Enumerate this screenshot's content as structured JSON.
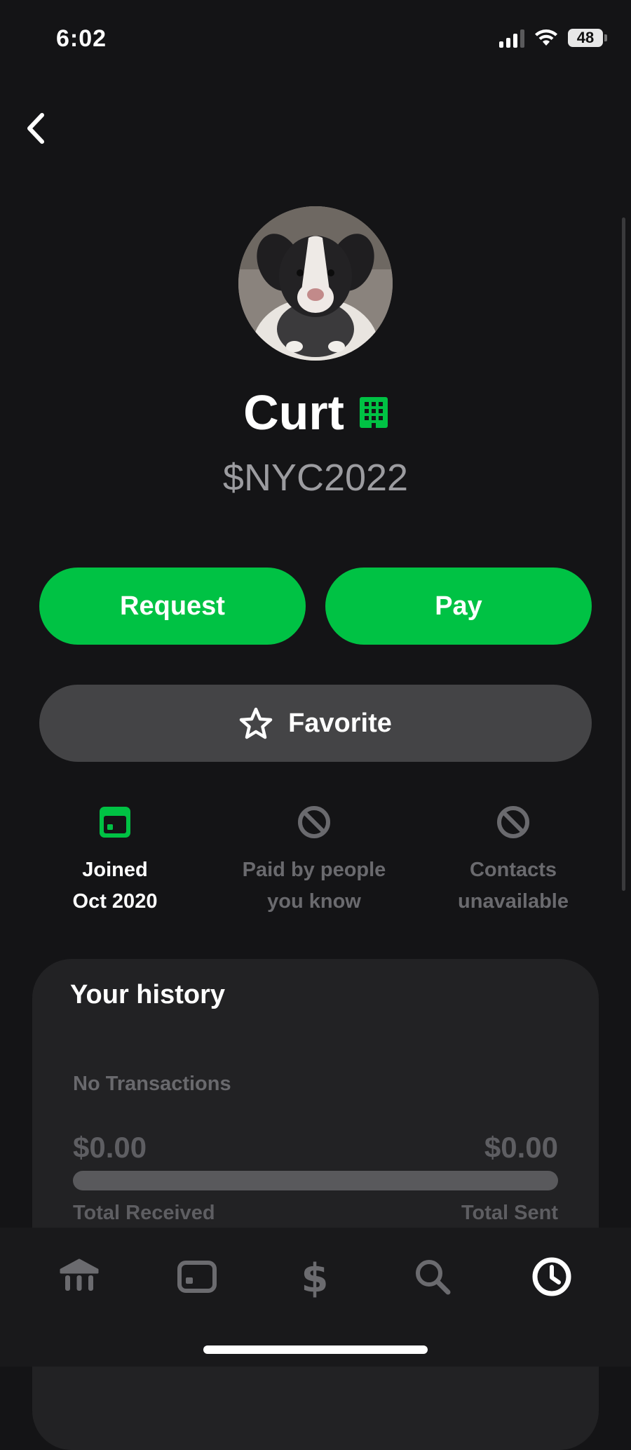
{
  "status_bar": {
    "time": "6:02",
    "battery": "48"
  },
  "profile": {
    "name": "Curt",
    "cashtag": "$NYC2022",
    "avatar_description": "puppy",
    "business_icon": "building-icon"
  },
  "actions": {
    "request_label": "Request",
    "pay_label": "Pay",
    "favorite_label": "Favorite"
  },
  "info": [
    {
      "line1": "Joined",
      "line2": "Oct 2020",
      "icon": "calendar-icon",
      "active": true
    },
    {
      "line1": "Paid by people",
      "line2": "you know",
      "icon": "blocked-icon",
      "active": false
    },
    {
      "line1": "Contacts",
      "line2": "unavailable",
      "icon": "blocked-icon",
      "active": false
    }
  ],
  "history": {
    "title": "Your history",
    "empty_text": "No Transactions",
    "received_amount": "$0.00",
    "sent_amount": "$0.00",
    "received_label": "Total Received",
    "sent_label": "Total Sent"
  },
  "tab_bar": {
    "tabs": [
      "banking-icon",
      "card-icon",
      "dollar-icon",
      "search-icon",
      "clock-icon"
    ],
    "active": "clock-icon"
  },
  "colors": {
    "accent": "#00c244",
    "background": "#141416",
    "card": "#222224",
    "button_secondary": "#444446"
  }
}
